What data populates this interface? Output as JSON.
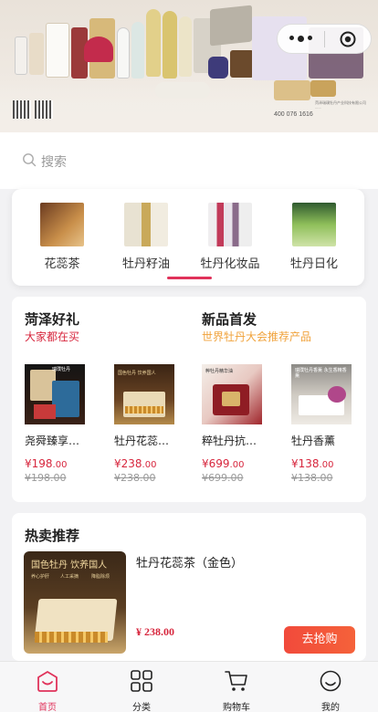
{
  "banner": {
    "phone": "400 076 1616",
    "company": "菏泽瑞璞牡丹产业科技有限公司 ......"
  },
  "search": {
    "placeholder": "搜索"
  },
  "categories": [
    {
      "label": "花蕊茶"
    },
    {
      "label": "牡丹籽油"
    },
    {
      "label": "牡丹化妆品"
    },
    {
      "label": "牡丹日化"
    }
  ],
  "promo": {
    "left": {
      "title": "菏泽好礼",
      "subtitle": "大家都在买"
    },
    "right": {
      "title": "新品首发",
      "subtitle": "世界牡丹大会推荐产品"
    },
    "items": [
      {
        "name": "尧舜臻享…",
        "price_int": "¥198",
        "price_dec": ".00",
        "old": "¥198.00",
        "img_text": "瑞璞牡丹"
      },
      {
        "name": "牡丹花蕊…",
        "price_int": "¥238",
        "price_dec": ".00",
        "old": "¥238.00",
        "img_text": "国色牡丹 饮养国人"
      },
      {
        "name": "粹牡丹抗…",
        "price_int": "¥699",
        "price_dec": ".00",
        "old": "¥699.00",
        "img_text": "粹牡丹精华油"
      },
      {
        "name": "牡丹香薰",
        "price_int": "¥138",
        "price_dec": ".00",
        "old": "¥138.00",
        "img_text": "瑞璞牡丹香薰 永生香精香薰"
      }
    ]
  },
  "hot": {
    "title": "热卖推荐",
    "item": {
      "name": "牡丹花蕊茶（金色）",
      "price": "¥ 238.00",
      "buy_label": "去抢购",
      "img_title": "国色牡丹 饮养国人",
      "img_tags": [
        "养心护肝",
        "人工采摘",
        "降脂除烦"
      ]
    }
  },
  "tabbar": [
    {
      "label": "首页",
      "icon": "home-icon",
      "active": true
    },
    {
      "label": "分类",
      "icon": "category-icon",
      "active": false
    },
    {
      "label": "购物车",
      "icon": "cart-icon",
      "active": false
    },
    {
      "label": "我的",
      "icon": "profile-icon",
      "active": false
    }
  ],
  "colors": {
    "accent": "#e0325a",
    "price": "#d7263d",
    "subtitle_left": "#d7263d",
    "subtitle_right": "#f0a23a"
  }
}
